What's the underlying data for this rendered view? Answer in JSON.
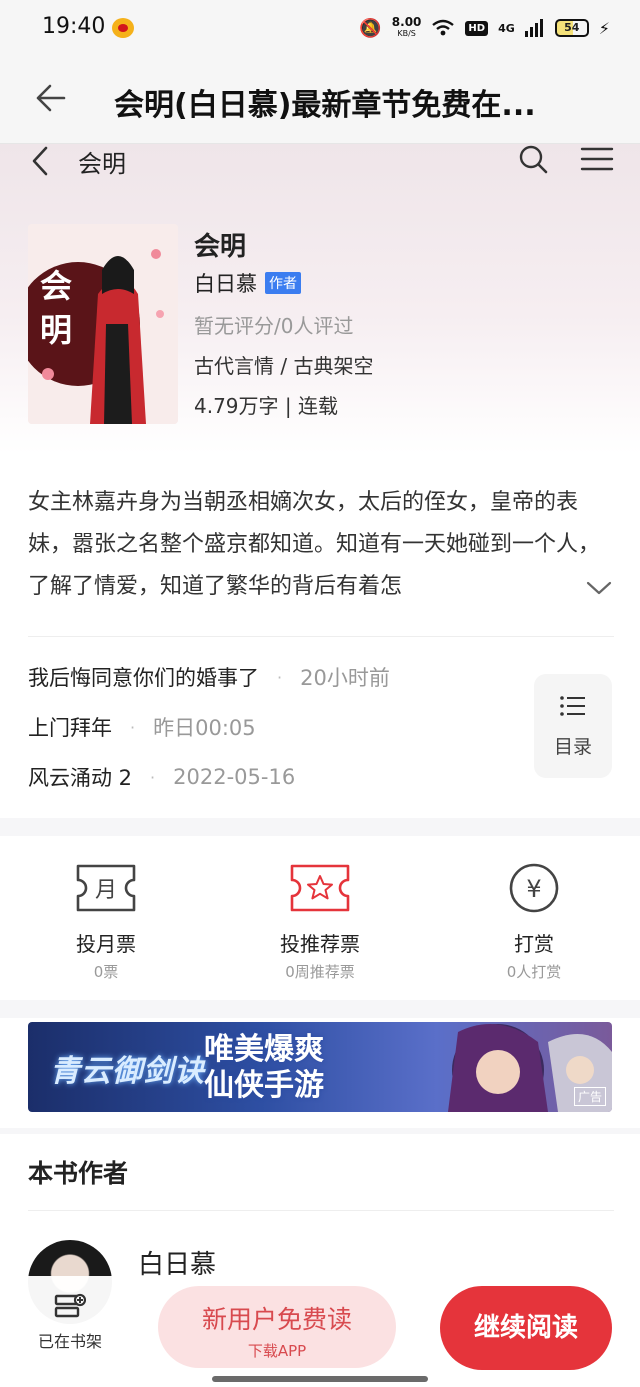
{
  "status_bar": {
    "time": "19:40",
    "net_speed_value": "8.00",
    "net_speed_unit": "KB/S",
    "hd": "HD",
    "signal": "4G",
    "battery": "54"
  },
  "browser": {
    "title": "会明(白日慕)最新章节免费在..."
  },
  "site_header": {
    "title": "会明"
  },
  "book": {
    "cover_title": "会明",
    "name": "会明",
    "author": "白日慕",
    "author_badge": "作者",
    "rating": "暂无评分/0人评过",
    "genre": "古代言情 / 古典架空",
    "stats": "4.79万字 | 连载",
    "synopsis": "女主林嘉卉身为当朝丞相嫡次女，太后的侄女，皇帝的表妹，嚣张之名整个盛京都知道。知道有一天她碰到一个人，了解了情爱，知道了繁华的背后有着怎"
  },
  "chapters": [
    {
      "title": "我后悔同意你们的婚事了",
      "time": "20小时前"
    },
    {
      "title": "上门拜年",
      "time": "昨日00:05"
    },
    {
      "title": "风云涌动 2",
      "time": "2022-05-16"
    }
  ],
  "toc": {
    "label": "目录"
  },
  "actions": [
    {
      "label": "投月票",
      "sub": "0票",
      "icon_text": "月"
    },
    {
      "label": "投推荐票",
      "sub": "0周推荐票"
    },
    {
      "label": "打赏",
      "sub": "0人打赏",
      "icon_text": "¥"
    }
  ],
  "banner": {
    "left_text": "青云御剑诀",
    "line1": "唯美爆爽",
    "line2": "仙侠手游",
    "tag": "广告"
  },
  "author_section": {
    "title": "本书作者",
    "name": "白日慕"
  },
  "bottom_bar": {
    "shelf_label": "已在书架",
    "free_main": "新用户免费读",
    "free_sub": "下载APP",
    "read_label": "继续阅读"
  },
  "colors": {
    "accent_red": "#e5343b",
    "badge_blue": "#3b7df0",
    "free_btn_bg": "#fbe1e2"
  }
}
